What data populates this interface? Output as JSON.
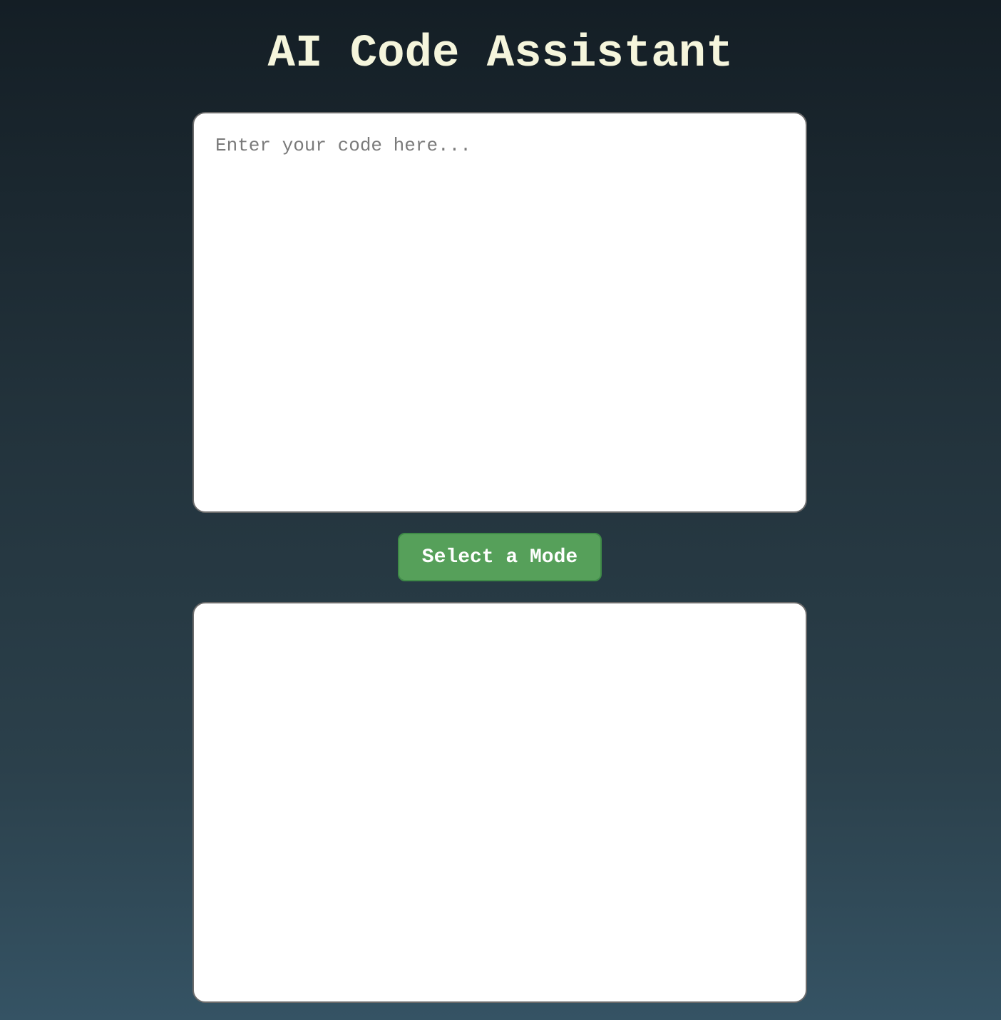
{
  "header": {
    "title": "AI Code Assistant"
  },
  "code_input": {
    "placeholder": "Enter your code here...",
    "value": ""
  },
  "mode_button": {
    "label": "Select a Mode"
  },
  "output": {
    "text": ""
  },
  "colors": {
    "title": "#f5f5dc",
    "button": "#56a05a",
    "panel": "#ffffff",
    "background_top": "#141e25",
    "background_bottom": "#355364"
  }
}
